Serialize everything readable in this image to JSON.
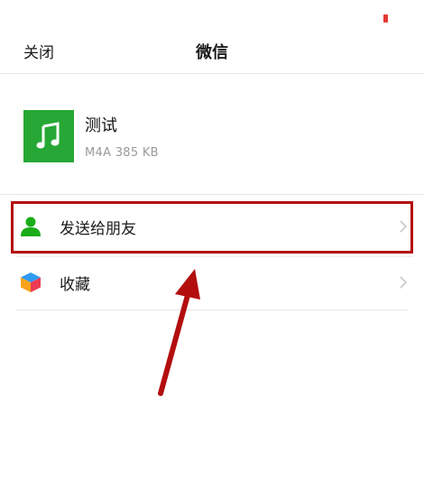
{
  "header": {
    "close_label": "关闭",
    "title": "微信"
  },
  "file": {
    "name": "测试",
    "meta": "M4A 385 KB",
    "icon": "music-note-icon"
  },
  "menu": {
    "items": [
      {
        "label": "发送给朋友",
        "icon": "person-icon"
      },
      {
        "label": "收藏",
        "icon": "cube-icon"
      }
    ]
  },
  "colors": {
    "file_icon_bg": "#27a836",
    "person_icon": "#1aad19",
    "annotation_red": "#b30e0e"
  }
}
